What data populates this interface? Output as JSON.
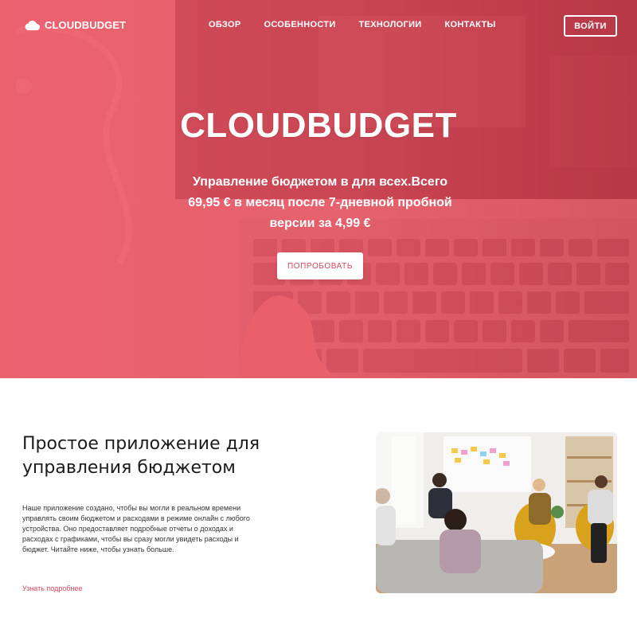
{
  "nav": {
    "logo_text": "CLOUDBUDGET",
    "links": [
      "ОБЗОР",
      "ОСОБЕННОСТИ",
      "ТЕХНОЛОГИИ",
      "КОНТАКТЫ"
    ],
    "login_label": "ВОЙТИ"
  },
  "hero": {
    "title": "CLOUDBUDGET",
    "subtitle": "Управление бюджетом в для всех.Всего 69,95 € в месяц после 7-дневной пробной версии за 4,99 €",
    "cta_label": "ПОПРОБОВАТЬ"
  },
  "about": {
    "title": "Простое приложение для управления бюджетом",
    "text": "Наше приложение создано, чтобы вы могли в реальном времени управлять своим бюджетом и расходами в режиме онлайн с любого устройства. Оно предоставляет подробные отчеты о доходах и расходах с графиками, чтобы вы сразу могли увидеть расходы и бюджет. Читайте ниже, чтобы узнать больше.",
    "link_label": "Узнать подробнее"
  },
  "colors": {
    "brand": "#e8485a",
    "link": "#e0455c",
    "white": "#ffffff"
  },
  "icons": {
    "logo": "cloud-icon"
  }
}
